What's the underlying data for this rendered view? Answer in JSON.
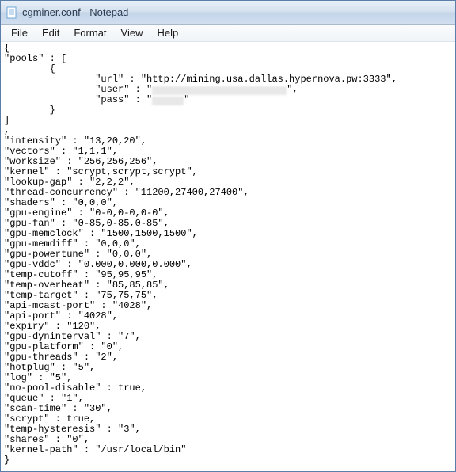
{
  "window": {
    "title": "cgminer.conf - Notepad"
  },
  "menu": {
    "file": "File",
    "edit": "Edit",
    "format": "Format",
    "view": "View",
    "help": "Help"
  },
  "doc": {
    "l0": "{",
    "l1": "\"pools\" : [",
    "l2": "        {",
    "l3": "                \"url\" : \"http://mining.usa.dallas.hypernova.pw:3333\",",
    "l4a": "                \"user\" : \"",
    "l4b": "\",",
    "l5a": "                \"pass\" : \"",
    "l5b": "\"",
    "l6": "        }",
    "l7": "]",
    "l8": ",",
    "l9": "\"intensity\" : \"13,20,20\",",
    "l10": "\"vectors\" : \"1,1,1\",",
    "l11": "\"worksize\" : \"256,256,256\",",
    "l12": "\"kernel\" : \"scrypt,scrypt,scrypt\",",
    "l13": "\"lookup-gap\" : \"2,2,2\",",
    "l14": "\"thread-concurrency\" : \"11200,27400,27400\",",
    "l15": "\"shaders\" : \"0,0,0\",",
    "l16": "\"gpu-engine\" : \"0-0,0-0,0-0\",",
    "l17": "\"gpu-fan\" : \"0-85,0-85,0-85\",",
    "l18": "\"gpu-memclock\" : \"1500,1500,1500\",",
    "l19": "\"gpu-memdiff\" : \"0,0,0\",",
    "l20": "\"gpu-powertune\" : \"0,0,0\",",
    "l21": "\"gpu-vddc\" : \"0.000,0.000,0.000\",",
    "l22": "\"temp-cutoff\" : \"95,95,95\",",
    "l23": "\"temp-overheat\" : \"85,85,85\",",
    "l24": "\"temp-target\" : \"75,75,75\",",
    "l25": "\"api-mcast-port\" : \"4028\",",
    "l26": "\"api-port\" : \"4028\",",
    "l27": "\"expiry\" : \"120\",",
    "l28": "\"gpu-dyninterval\" : \"7\",",
    "l29": "\"gpu-platform\" : \"0\",",
    "l30": "\"gpu-threads\" : \"2\",",
    "l31": "\"hotplug\" : \"5\",",
    "l32": "\"log\" : \"5\",",
    "l33": "\"no-pool-disable\" : true,",
    "l34": "\"queue\" : \"1\",",
    "l35": "\"scan-time\" : \"30\",",
    "l36": "\"scrypt\" : true,",
    "l37": "\"temp-hysteresis\" : \"3\",",
    "l38": "\"shares\" : \"0\",",
    "l39": "\"kernel-path\" : \"/usr/local/bin\"",
    "l40": "}"
  }
}
